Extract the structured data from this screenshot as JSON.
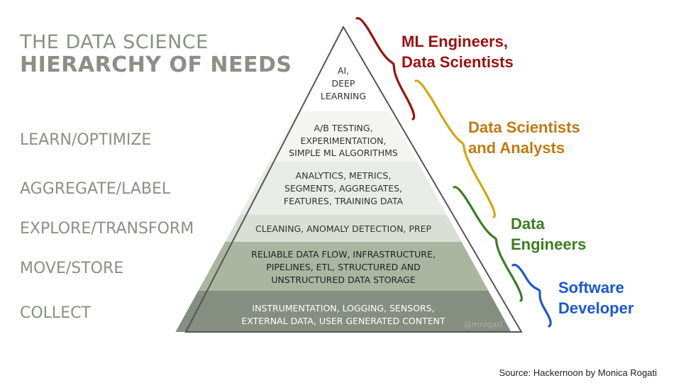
{
  "title": {
    "line1": "THE DATA SCIENCE",
    "line2": "HIERARCHY OF NEEDS"
  },
  "levels": [
    "LEARN/OPTIMIZE",
    "AGGREGATE/LABEL",
    "EXPLORE/TRANSFORM",
    "MOVE/STORE",
    "COLLECT"
  ],
  "pyramid": {
    "tiers": [
      {
        "lines": [
          "AI,",
          "DEEP",
          "LEARNING"
        ],
        "fill": "#ffffff",
        "text_color": "#333333"
      },
      {
        "lines": [
          "A/B TESTING,",
          "EXPERIMENTATION,",
          "SIMPLE ML ALGORITHMS"
        ],
        "fill": "#f4f5f2",
        "text_color": "#333333"
      },
      {
        "lines": [
          "ANALYTICS, METRICS,",
          "SEGMENTS, AGGREGATES,",
          "FEATURES, TRAINING DATA"
        ],
        "fill": "#e9ebe6",
        "text_color": "#333333"
      },
      {
        "lines": [
          "CLEANING, ANOMALY DETECTION, PREP"
        ],
        "fill": "#d9ddd4",
        "text_color": "#333333"
      },
      {
        "lines": [
          "RELIABLE DATA FLOW, INFRASTRUCTURE,",
          "PIPELINES, ETL, STRUCTURED AND",
          "UNSTRUCTURED DATA STORAGE"
        ],
        "fill": "#aab6a0",
        "text_color": "#222222"
      },
      {
        "lines": [
          "INSTRUMENTATION, LOGGING, SENSORS,",
          "EXTERNAL DATA, USER GENERATED CONTENT"
        ],
        "fill": "#858e80",
        "text_color": "#ffffff"
      }
    ],
    "watermark": "@mrogati"
  },
  "roles": [
    {
      "lines": [
        "ML Engineers,",
        "Data Scientists"
      ],
      "color": "#9b1111"
    },
    {
      "lines": [
        "Data Scientists",
        "and Analysts"
      ],
      "color": "#c07a12"
    },
    {
      "lines": [
        "Data",
        "Engineers"
      ],
      "color": "#3a7d22"
    },
    {
      "lines": [
        "Software",
        "Developer"
      ],
      "color": "#1b58cf"
    }
  ],
  "brace_colors": [
    "#9b1111",
    "#ccaa10",
    "#3a7d22",
    "#1b58cf"
  ],
  "source": "Source: Hackernoon by Monica Rogati"
}
